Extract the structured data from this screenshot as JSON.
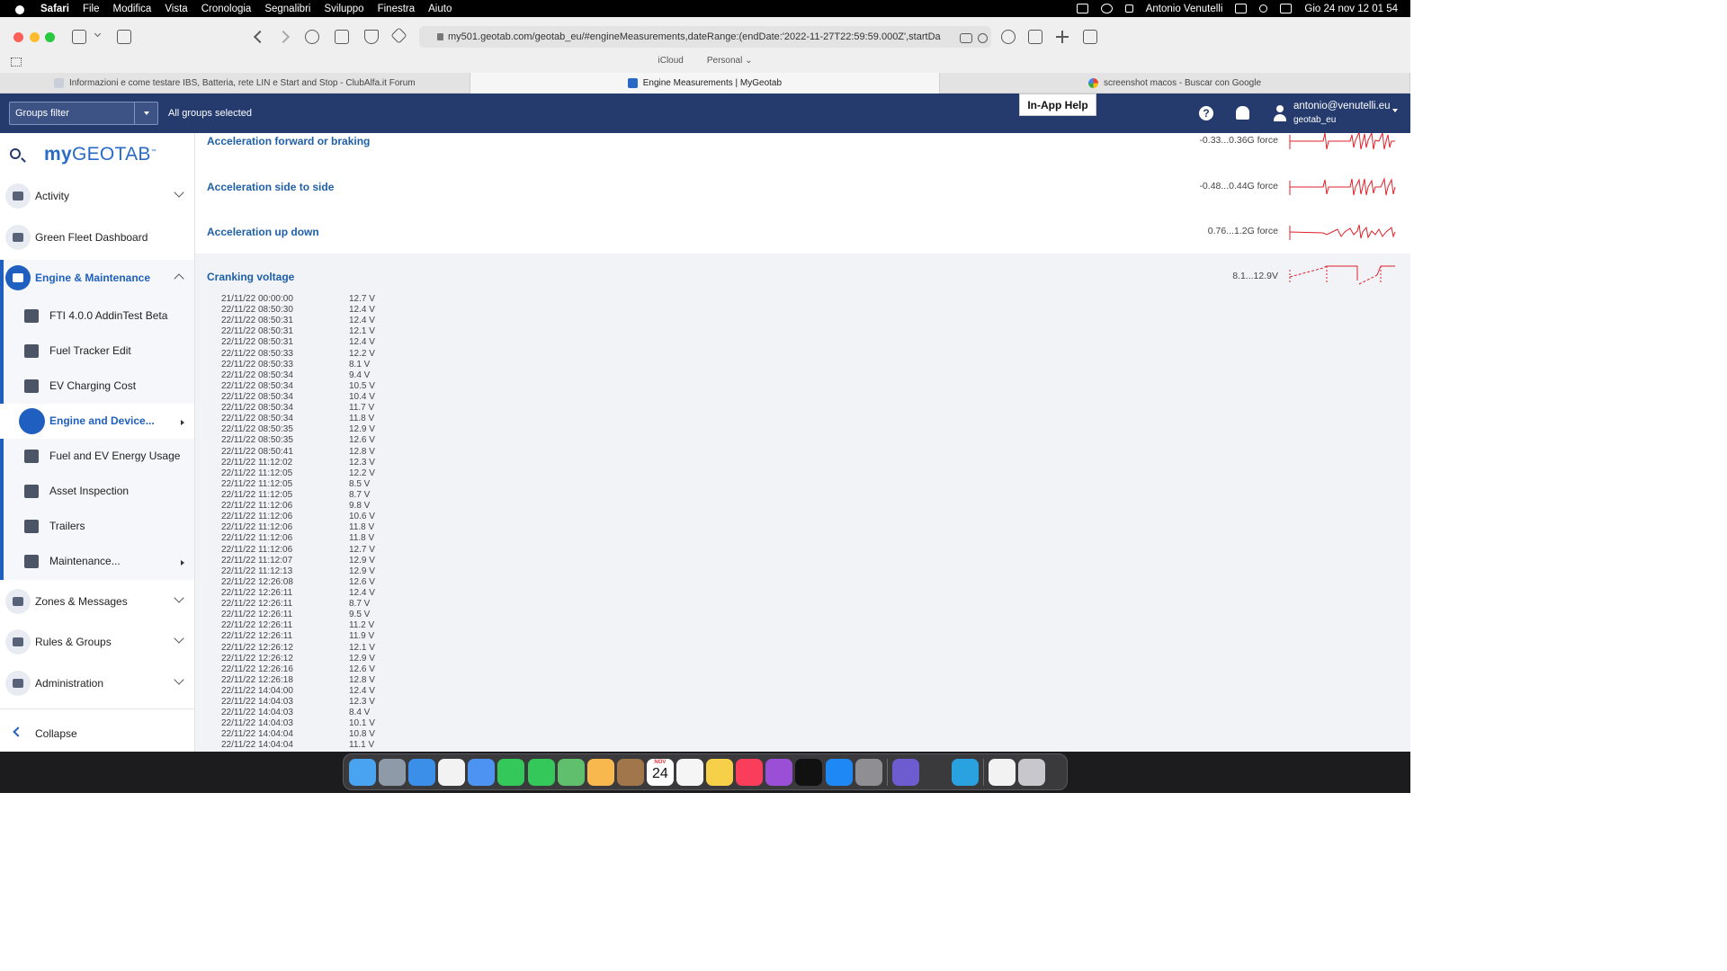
{
  "menubar": {
    "items": [
      "Safari",
      "File",
      "Modifica",
      "Vista",
      "Cronologia",
      "Segnalibri",
      "Sviluppo",
      "Finestra",
      "Aiuto"
    ],
    "user": "Antonio Venutelli",
    "datetime": "Gio 24 nov  12 01 54"
  },
  "browser": {
    "url": "my501.geotab.com/geotab_eu/#engineMeasurements,dateRange:(endDate:'2022-11-27T22:59:59.000Z',startDa",
    "favorites": [
      "iCloud",
      "Personal"
    ],
    "tabs": [
      {
        "title": "Informazioni e come testare IBS, Batteria, rete LIN e Start and Stop - ClubAlfa.it Forum",
        "icon": "forum-favicon"
      },
      {
        "title": "Engine Measurements | MyGeotab",
        "icon": "mygeotab-favicon"
      },
      {
        "title": "screenshot macos - Buscar con Google",
        "icon": "google-favicon"
      }
    ]
  },
  "header": {
    "groups_filter": "Groups filter",
    "groups_selected": "All groups selected",
    "in_app_help": "In-App Help",
    "help_glyph": "?",
    "user_email": "antonio@venutelli.eu",
    "user_database": "geotab_eu"
  },
  "sidebar": {
    "logo": {
      "prefix": "my",
      "name": "GEOTAB",
      "tm": "™"
    },
    "items": [
      {
        "label": "Activity"
      },
      {
        "label": "Green Fleet Dashboard"
      },
      {
        "label": "Engine & Maintenance"
      },
      {
        "label": "Zones & Messages"
      },
      {
        "label": "Rules & Groups"
      },
      {
        "label": "Administration"
      }
    ],
    "sub_items": [
      {
        "label": "FTI 4.0.0 AddinTest Beta"
      },
      {
        "label": "Fuel Tracker Edit"
      },
      {
        "label": "EV Charging Cost"
      },
      {
        "label": "Engine and Device..."
      },
      {
        "label": "Fuel and EV Energy Usage"
      },
      {
        "label": "Asset Inspection"
      },
      {
        "label": "Trailers"
      },
      {
        "label": "Maintenance..."
      }
    ],
    "collapse": "Collapse"
  },
  "measurements": [
    {
      "name": "Acceleration forward or braking",
      "range": "-0.33...0.36G force"
    },
    {
      "name": "Acceleration side to side",
      "range": "-0.48...0.44G force"
    },
    {
      "name": "Acceleration up down",
      "range": "0.76...1.2G force"
    }
  ],
  "cranking": {
    "name": "Cranking voltage",
    "range": "8.1...12.9V",
    "readings": [
      {
        "t": "21/11/22 00:00:00",
        "v": "12.7 V"
      },
      {
        "t": "22/11/22 08:50:30",
        "v": "12.4 V"
      },
      {
        "t": "22/11/22 08:50:31",
        "v": "12.4 V"
      },
      {
        "t": "22/11/22 08:50:31",
        "v": "12.1 V"
      },
      {
        "t": "22/11/22 08:50:31",
        "v": "12.4 V"
      },
      {
        "t": "22/11/22 08:50:33",
        "v": "12.2 V"
      },
      {
        "t": "22/11/22 08:50:33",
        "v": "8.1 V"
      },
      {
        "t": "22/11/22 08:50:34",
        "v": "9.4 V"
      },
      {
        "t": "22/11/22 08:50:34",
        "v": "10.5 V"
      },
      {
        "t": "22/11/22 08:50:34",
        "v": "10.4 V"
      },
      {
        "t": "22/11/22 08:50:34",
        "v": "11.7 V"
      },
      {
        "t": "22/11/22 08:50:34",
        "v": "11.8 V"
      },
      {
        "t": "22/11/22 08:50:35",
        "v": "12.9 V"
      },
      {
        "t": "22/11/22 08:50:35",
        "v": "12.6 V"
      },
      {
        "t": "22/11/22 08:50:41",
        "v": "12.8 V"
      },
      {
        "t": "22/11/22 11:12:02",
        "v": "12.3 V"
      },
      {
        "t": "22/11/22 11:12:05",
        "v": "12.2 V"
      },
      {
        "t": "22/11/22 11:12:05",
        "v": "8.5 V"
      },
      {
        "t": "22/11/22 11:12:05",
        "v": "8.7 V"
      },
      {
        "t": "22/11/22 11:12:06",
        "v": "9.8 V"
      },
      {
        "t": "22/11/22 11:12:06",
        "v": "10.6 V"
      },
      {
        "t": "22/11/22 11:12:06",
        "v": "11.8 V"
      },
      {
        "t": "22/11/22 11:12:06",
        "v": "11.8 V"
      },
      {
        "t": "22/11/22 11:12:06",
        "v": "12.7 V"
      },
      {
        "t": "22/11/22 11:12:07",
        "v": "12.9 V"
      },
      {
        "t": "22/11/22 11:12:13",
        "v": "12.9 V"
      },
      {
        "t": "22/11/22 12:26:08",
        "v": "12.6 V"
      },
      {
        "t": "22/11/22 12:26:11",
        "v": "12.4 V"
      },
      {
        "t": "22/11/22 12:26:11",
        "v": "8.7 V"
      },
      {
        "t": "22/11/22 12:26:11",
        "v": "9.5 V"
      },
      {
        "t": "22/11/22 12:26:11",
        "v": "11.2 V"
      },
      {
        "t": "22/11/22 12:26:11",
        "v": "11.9 V"
      },
      {
        "t": "22/11/22 12:26:12",
        "v": "12.1 V"
      },
      {
        "t": "22/11/22 12:26:12",
        "v": "12.9 V"
      },
      {
        "t": "22/11/22 12:26:16",
        "v": "12.6 V"
      },
      {
        "t": "22/11/22 12:26:18",
        "v": "12.8 V"
      },
      {
        "t": "22/11/22 14:04:00",
        "v": "12.4 V"
      },
      {
        "t": "22/11/22 14:04:03",
        "v": "12.3 V"
      },
      {
        "t": "22/11/22 14:04:03",
        "v": "8.4 V"
      },
      {
        "t": "22/11/22 14:04:03",
        "v": "10.1 V"
      },
      {
        "t": "22/11/22 14:04:04",
        "v": "10.8 V"
      },
      {
        "t": "22/11/22 14:04:04",
        "v": "11.1 V"
      }
    ]
  },
  "dock": {
    "calendar_day": "24",
    "calendar_month": "NOV",
    "apps": [
      "finder-icon",
      "launchpad-icon",
      "safari-icon",
      "chrome-icon",
      "mail-icon",
      "facetime-icon",
      "messages-icon",
      "maps-icon",
      "photos-icon",
      "notes-brown-icon",
      "calendar-icon",
      "reminders-icon",
      "notes-icon",
      "music-icon",
      "podcasts-icon",
      "tv-icon",
      "app-store-icon",
      "system-preferences-icon",
      "vpn-icon",
      "calculator-icon",
      "telegram-icon",
      "documents-icon",
      "trash-icon"
    ]
  },
  "colors": {
    "header_bg": "#253b6e",
    "accent": "#1f5fbf",
    "sparkline": "#e0202a"
  }
}
